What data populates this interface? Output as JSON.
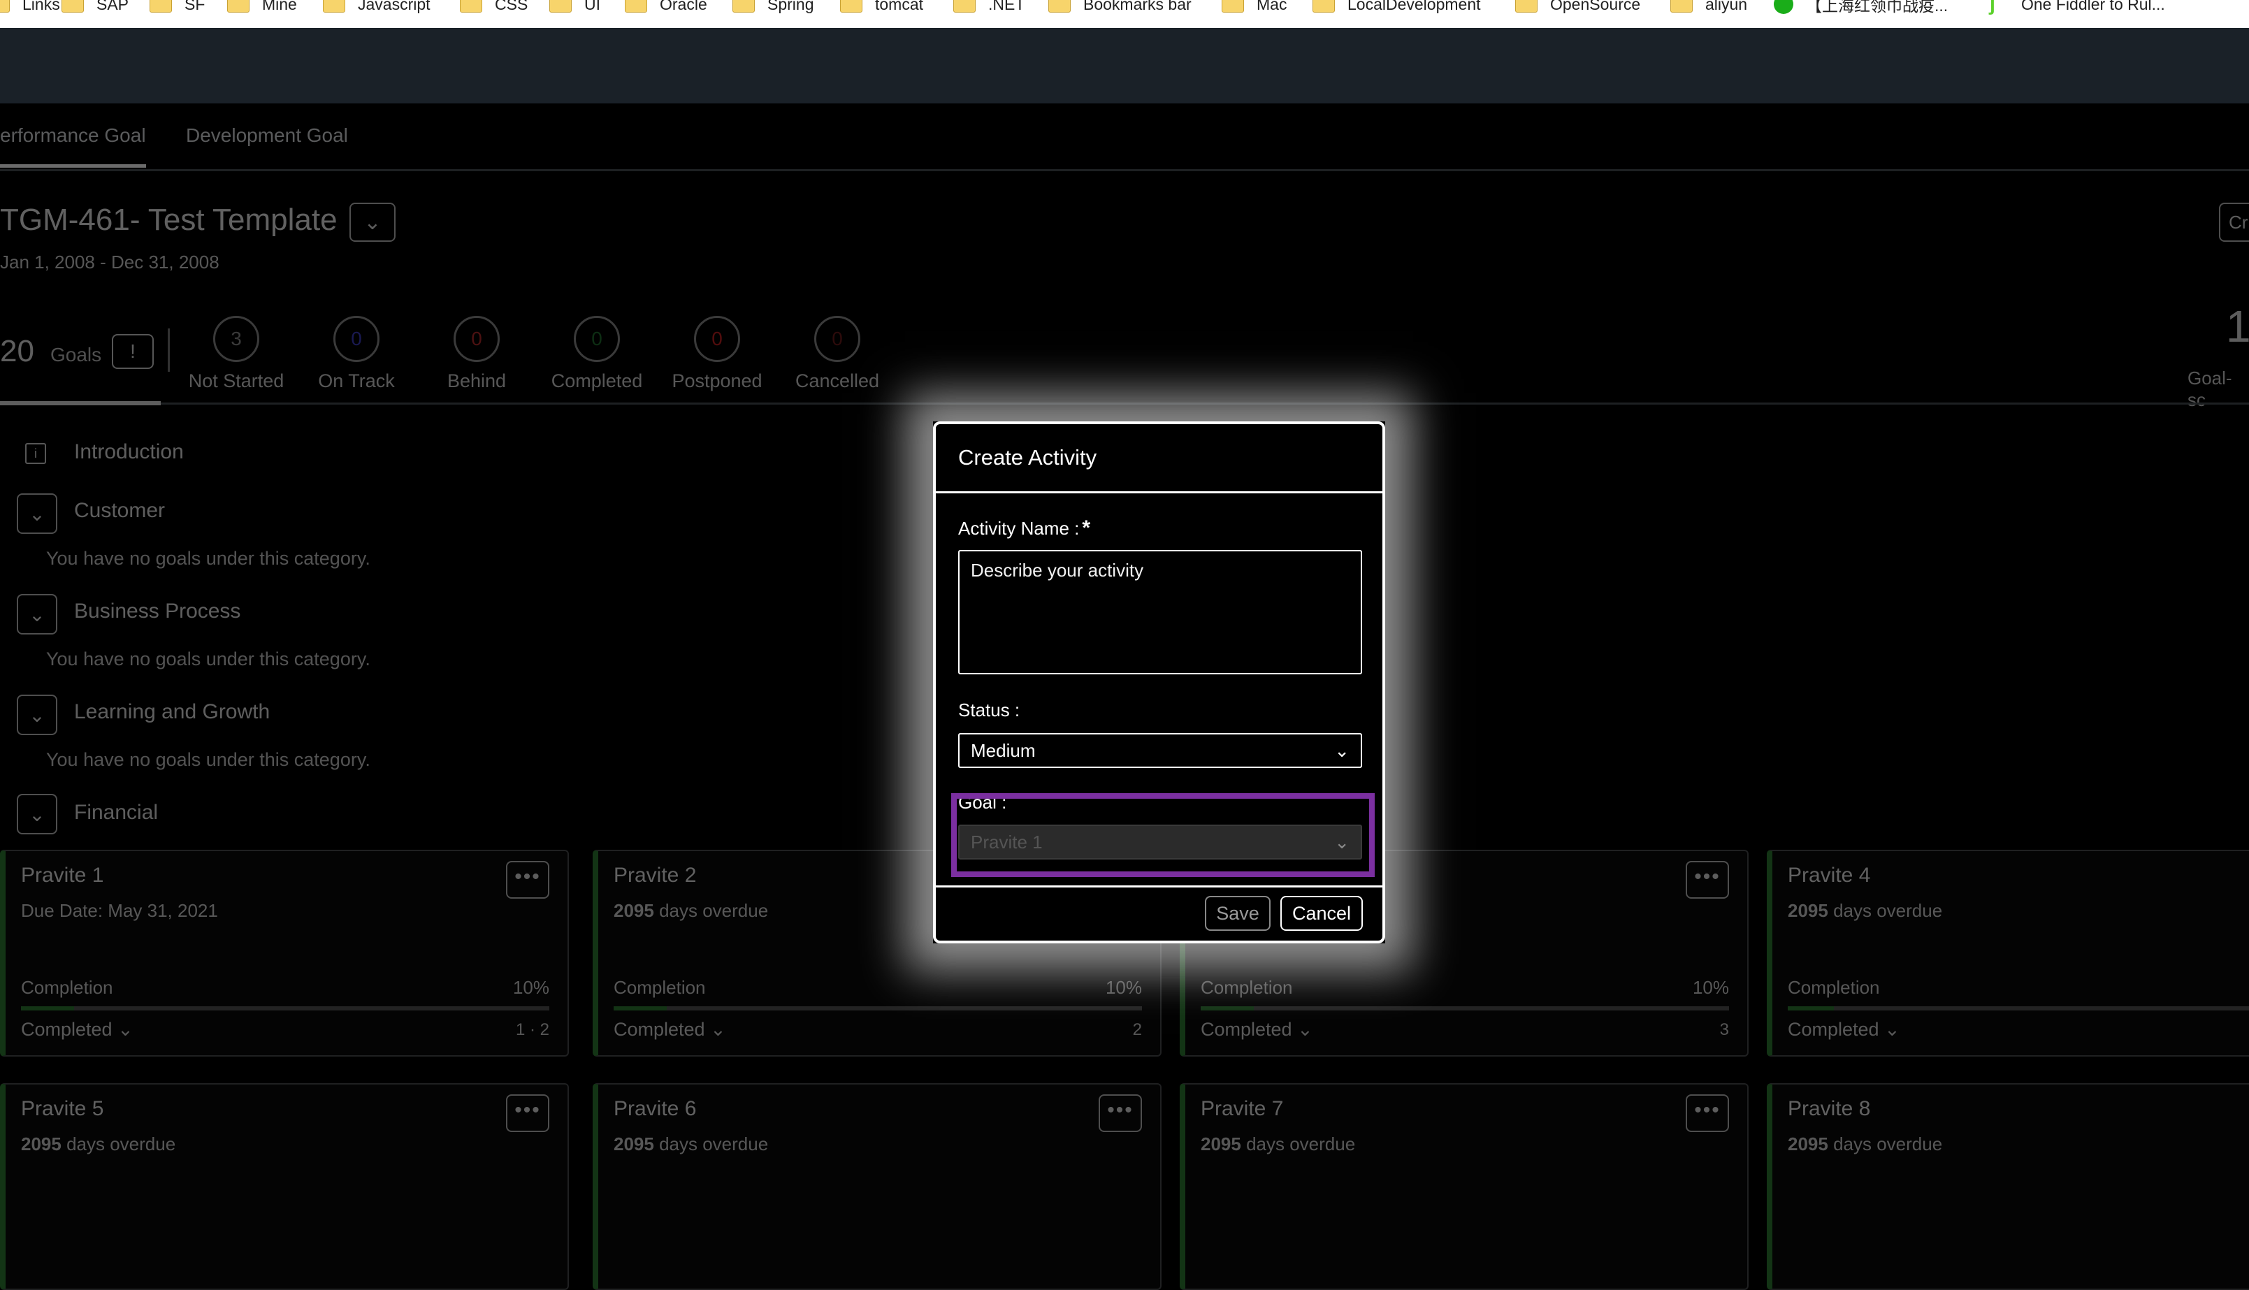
{
  "bookmarks": [
    {
      "label": "Links",
      "icon": "folder-icon"
    },
    {
      "label": "SAP",
      "icon": "folder-icon"
    },
    {
      "label": "SF",
      "icon": "folder-icon"
    },
    {
      "label": "Mine",
      "icon": "folder-icon"
    },
    {
      "label": "Javascript",
      "icon": "folder-icon"
    },
    {
      "label": "CSS",
      "icon": "folder-icon"
    },
    {
      "label": "UI",
      "icon": "folder-icon"
    },
    {
      "label": "Oracle",
      "icon": "folder-icon"
    },
    {
      "label": "Spring",
      "icon": "folder-icon"
    },
    {
      "label": "tomcat",
      "icon": "folder-icon"
    },
    {
      "label": ".NET",
      "icon": "folder-icon"
    },
    {
      "label": "Bookmarks bar",
      "icon": "folder-icon"
    },
    {
      "label": "Mac",
      "icon": "folder-icon"
    },
    {
      "label": "LocalDevelopment",
      "icon": "folder-icon"
    },
    {
      "label": "OpenSource",
      "icon": "folder-icon"
    },
    {
      "label": "aliyun",
      "icon": "folder-icon"
    },
    {
      "label": "【上海红领巾战疫...",
      "icon": "favicon-icon"
    },
    {
      "label": "One Fiddler to Rul...",
      "icon": "favicon-icon"
    }
  ],
  "tabs": {
    "performance": "erformance Goal",
    "development": "Development Goal"
  },
  "header": {
    "title": "TGM-461- Test Template",
    "dates": "Jan 1, 2008 - Dec 31, 2008",
    "create_button": "Cr"
  },
  "summary": {
    "count": "20",
    "goals_label": "Goals",
    "alert_icon": "!",
    "right_number": "1",
    "right_label": "Goal-sc",
    "stats": [
      {
        "value": "3",
        "label": "Not Started",
        "color": "#8a8a8a"
      },
      {
        "value": "0",
        "label": "On Track",
        "color": "#3d3dc0"
      },
      {
        "value": "0",
        "label": "Behind",
        "color": "#b52a2a"
      },
      {
        "value": "0",
        "label": "Completed",
        "color": "#1f6e2e"
      },
      {
        "value": "0",
        "label": "Postponed",
        "color": "#c32020"
      },
      {
        "value": "0",
        "label": "Cancelled",
        "color": "#6b1b1b"
      }
    ]
  },
  "sections": {
    "introduction": "Introduction",
    "customer": "Customer",
    "business": "Business Process",
    "learning": "Learning and Growth",
    "financial": "Financial",
    "empty_msg": "You have no goals under this category."
  },
  "cards": [
    {
      "name": "Pravite 1",
      "due": "Due Date: May 31, 2021",
      "completion_label": "Completion",
      "pct": "10%",
      "progress": 10,
      "status": "Completed",
      "icons": "1 · 2"
    },
    {
      "name": "Pravite 2",
      "due_num": "2095",
      "due_text": " days overdue",
      "completion_label": "Completion",
      "pct": "10%",
      "progress": 10,
      "status": "Completed",
      "icons": "2"
    },
    {
      "name": "",
      "completion_label": "Completion",
      "pct": "10%",
      "progress": 10,
      "status": "Completed",
      "icons": "3"
    },
    {
      "name": "Pravite 4",
      "due_num": "2095",
      "due_text": " days overdue",
      "completion_label": "Completion",
      "status": "Completed"
    },
    {
      "name": "Pravite 5",
      "due_num": "2095",
      "due_text": " days overdue"
    },
    {
      "name": "Pravite 6",
      "due_num": "2095",
      "due_text": " days overdue"
    },
    {
      "name": "Pravite 7",
      "due_num": "2095",
      "due_text": " days overdue"
    },
    {
      "name": "Pravite 8",
      "due_num": "2095",
      "due_text": " days overdue"
    }
  ],
  "dialog": {
    "title": "Create Activity",
    "activity_label": "Activity Name :",
    "required_mark": "*",
    "activity_placeholder": "Describe your activity",
    "status_label": "Status :",
    "status_value": "Medium",
    "goal_label": "Goal :",
    "goal_value": "Pravite 1",
    "save": "Save",
    "cancel": "Cancel",
    "focus_color": "#7b2fa0"
  }
}
